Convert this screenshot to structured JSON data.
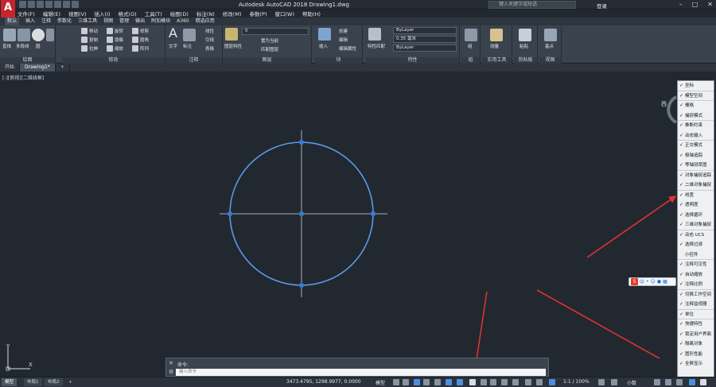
{
  "app": {
    "title": "Autodesk AutoCAD 2018    Drawing1.dwg",
    "logo": "A",
    "search_placeholder": "键入关键字或短语",
    "login": "登录"
  },
  "menubar": [
    "文件(F)",
    "编辑(E)",
    "视图(V)",
    "插入(I)",
    "格式(O)",
    "工具(T)",
    "绘图(D)",
    "标注(N)",
    "修改(M)",
    "参数(P)",
    "窗口(W)",
    "帮助(H)"
  ],
  "ribbon_tabs": [
    "默认",
    "插入",
    "注释",
    "参数化",
    "三维工具",
    "视图",
    "管理",
    "输出",
    "附加模块",
    "A360",
    "精选应用"
  ],
  "ribbon": {
    "draw": {
      "title": "绘图",
      "line": "直线",
      "polyline": "多段线",
      "circle": "圆",
      "arc": "圆弧"
    },
    "modify": {
      "title": "修改",
      "move": "移动",
      "rotate": "旋转",
      "trim": "修剪",
      "copy": "复制",
      "mirror": "镜像",
      "fillet": "圆角",
      "stretch": "拉伸",
      "scale": "缩放",
      "array": "阵列"
    },
    "annotation": {
      "title": "注释",
      "text": "文字",
      "dim": "标注",
      "linear": "线性",
      "leader": "引线",
      "table": "表格"
    },
    "layers": {
      "title": "图层",
      "props": "图层特性",
      "layer_value": "0",
      "make_current": "置为当前",
      "match": "匹配图层"
    },
    "block": {
      "title": "块",
      "insert": "插入",
      "create": "创建",
      "edit": "编辑",
      "edit_attr": "编辑属性"
    },
    "properties": {
      "title": "特性",
      "match": "特性匹配",
      "color": "ByLayer",
      "lineweight": "0.35 毫米",
      "linetype": "ByLayer"
    },
    "groups": {
      "title": "组",
      "group": "组"
    },
    "utilities": {
      "title": "实用工具",
      "measure": "测量"
    },
    "clipboard": {
      "title": "剪贴板",
      "paste": "粘贴"
    },
    "view": {
      "title": "视图",
      "base": "基点"
    }
  },
  "file_tabs": [
    "开始",
    "Drawing1*"
  ],
  "viewport_label": "[-][俯视][二维线框]",
  "compass_label": "西",
  "ucs": {
    "x": "X",
    "y": "Y"
  },
  "command": {
    "history": "命令:",
    "placeholder": "键入命令"
  },
  "layout_tabs": [
    "模型",
    "布局1",
    "布局2"
  ],
  "status": {
    "coords": "3473.4795, 1298.9977, 0.0000",
    "model": "模型",
    "scale": "1:1 / 100%",
    "units": "小数"
  },
  "menu_items": [
    {
      "label": "坐标",
      "checked": true,
      "sep": true
    },
    {
      "label": "模型空间",
      "checked": true,
      "sep": true
    },
    {
      "label": "栅格",
      "checked": true,
      "sep": false
    },
    {
      "label": "捕捉模式",
      "checked": true,
      "sep": true
    },
    {
      "label": "推断约束",
      "checked": true,
      "sep": false
    },
    {
      "label": "动态输入",
      "checked": true,
      "sep": true
    },
    {
      "label": "正交模式",
      "checked": true,
      "sep": false
    },
    {
      "label": "极轴追踪",
      "checked": true,
      "sep": false
    },
    {
      "label": "等轴测草图",
      "checked": true,
      "sep": true
    },
    {
      "label": "对象捕捉追踪",
      "checked": true,
      "sep": false
    },
    {
      "label": "二维对象捕捉",
      "checked": true,
      "sep": true
    },
    {
      "label": "线宽",
      "checked": true,
      "sep": false
    },
    {
      "label": "透明度",
      "checked": true,
      "sep": false
    },
    {
      "label": "选择循环",
      "checked": true,
      "sep": false
    },
    {
      "label": "三维对象捕捉",
      "checked": true,
      "sep": true
    },
    {
      "label": "动态 UCS",
      "checked": true,
      "sep": false
    },
    {
      "label": "选择过滤",
      "checked": true,
      "sep": false
    },
    {
      "label": "小控件",
      "checked": false,
      "sep": true
    },
    {
      "label": "注释可见性",
      "checked": true,
      "sep": false
    },
    {
      "label": "自动缩放",
      "checked": true,
      "sep": false
    },
    {
      "label": "注释比例",
      "checked": true,
      "sep": true
    },
    {
      "label": "切换工作空间",
      "checked": true,
      "sep": false
    },
    {
      "label": "注释监视器",
      "checked": true,
      "sep": true
    },
    {
      "label": "单位",
      "checked": true,
      "sep": true
    },
    {
      "label": "快捷特性",
      "checked": true,
      "sep": false
    },
    {
      "label": "锁定用户界面",
      "checked": true,
      "sep": false
    },
    {
      "label": "隔离对象",
      "checked": true,
      "sep": false
    },
    {
      "label": "图形性能",
      "checked": true,
      "sep": false
    },
    {
      "label": "全屏显示",
      "checked": true,
      "sep": false
    }
  ],
  "colors": {
    "circle": "#5b9ae8",
    "grip": "#2f7fe0",
    "axis": "#a9aeb5",
    "arrow": "#e0322f",
    "canvas": "#212830"
  }
}
